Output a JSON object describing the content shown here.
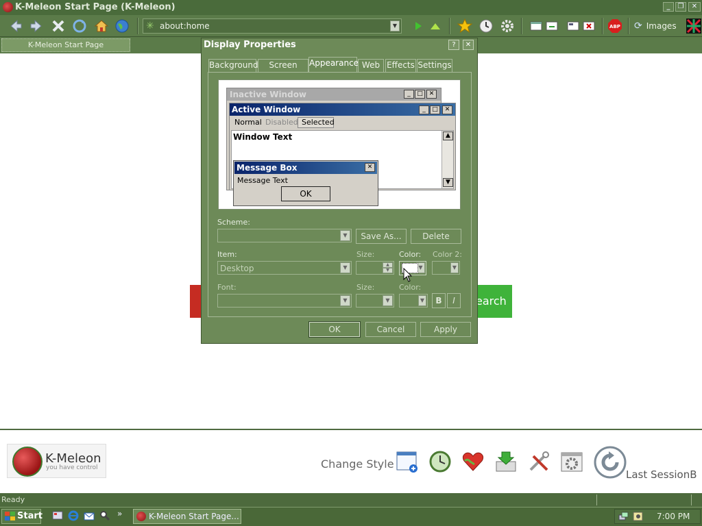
{
  "browser": {
    "title": "K-Meleon Start Page (K-Meleon)",
    "url": "about:home",
    "images_label": "Images",
    "tab_label": "K-Meleon Start Page",
    "status": "Ready"
  },
  "page": {
    "search_label": "earch",
    "logo_name": "K-Meleon",
    "logo_tagline": "you have control",
    "change_style": "Change Style",
    "last_session": "Last SessionB"
  },
  "dialog": {
    "title": "Display Properties",
    "tabs": [
      "Background",
      "Screen Saver",
      "Appearance",
      "Web",
      "Effects",
      "Settings"
    ],
    "active_tab": "Appearance",
    "preview": {
      "inactive_window": "Inactive Window",
      "active_window": "Active Window",
      "menu_normal": "Normal",
      "menu_disabled": "Disabled",
      "menu_selected": "Selected",
      "window_text": "Window Text",
      "message_box": "Message Box",
      "message_text": "Message Text",
      "ok": "OK"
    },
    "scheme_label": "Scheme:",
    "save_as": "Save As...",
    "delete": "Delete",
    "item_label": "Item:",
    "item_value": "Desktop",
    "size_label": "Size:",
    "color_label": "Color:",
    "color2_label": "Color 2:",
    "font_label": "Font:",
    "font_size_label": "Size:",
    "font_color_label": "Color:",
    "bold": "B",
    "italic": "I",
    "ok": "OK",
    "cancel": "Cancel",
    "apply": "Apply"
  },
  "taskbar": {
    "start": "Start",
    "task_button": "K-Meleon Start Page...",
    "clock": "7:00 PM",
    "overflow": "»"
  },
  "colors": {
    "theme_green": "#5b7b49",
    "search_green": "#3fb33a",
    "active_title_blue": "#0a246a"
  }
}
